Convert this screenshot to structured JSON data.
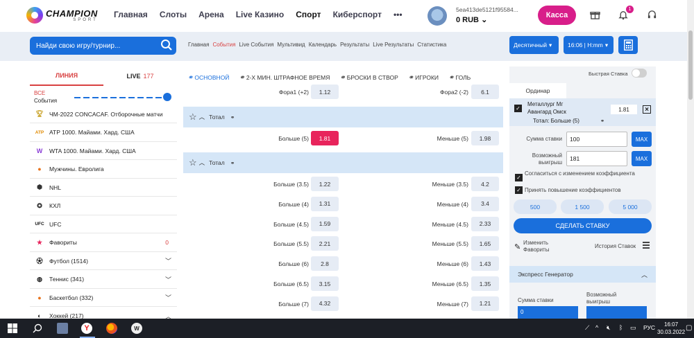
{
  "brand": {
    "name": "CHAMPION",
    "sub": "SPORT"
  },
  "nav": [
    "Главная",
    "Слоты",
    "Арена",
    "Live Казино",
    "Спорт",
    "Киберспорт",
    "•••"
  ],
  "account": {
    "id": "5ea413de5121f95584...",
    "balance": "0 RUB",
    "cashier": "Касса",
    "notifications": "1"
  },
  "search": {
    "placeholder": "Найди свою игру/турнир..."
  },
  "subnav": [
    "Главная",
    "События",
    "Live События",
    "Мультивид",
    "Календарь",
    "Результаты",
    "Live Результаты",
    "Статистика"
  ],
  "odds_format": "Десятичный",
  "time_format": "16:06 | H:mm",
  "sidebar": {
    "tab_line": "ЛИНИЯ",
    "tab_live": "LIVE",
    "live_count": "177",
    "events_all": "ВСЕ",
    "events_label": "События",
    "items": [
      {
        "label": "ЧМ-2022 CONCACAF. Отборочные матчи",
        "icon": "trophy-icon",
        "count": ""
      },
      {
        "label": "ATP 1000. Майами. Хард. США",
        "icon": "atp-logo-icon",
        "count": ""
      },
      {
        "label": "WTA 1000. Майами. Хард. США",
        "icon": "wta-logo-icon",
        "count": ""
      },
      {
        "label": "Мужчины. Евролига",
        "icon": "basketball-icon",
        "count": ""
      },
      {
        "label": "NHL",
        "icon": "nhl-logo-icon",
        "count": ""
      },
      {
        "label": "КХЛ",
        "icon": "khl-logo-icon",
        "count": ""
      },
      {
        "label": "UFC",
        "icon": "ufc-logo-icon",
        "count": ""
      },
      {
        "label": "Фавориты",
        "icon": "star-icon",
        "count": "0"
      },
      {
        "label": "Футбол (1514)",
        "icon": "football-icon",
        "count": ""
      },
      {
        "label": "Теннис (341)",
        "icon": "tennis-icon",
        "count": ""
      },
      {
        "label": "Баскетбол (332)",
        "icon": "basketball-icon",
        "count": ""
      },
      {
        "label": "Хоккей (217)",
        "icon": "hockey-icon",
        "count": ""
      }
    ]
  },
  "market_tabs": [
    "ОСНОВНОЙ",
    "2-Х МИН. ШТРАФНОЕ ВРЕМЯ",
    "БРОСКИ В СТВОР",
    "ИГРОКИ",
    "ГОЛЬ"
  ],
  "markets": {
    "fora_row": {
      "left_label": "Фора1 (+2)",
      "left_odd": "1.12",
      "right_label": "Фора2 (-2)",
      "right_odd": "6.1"
    },
    "total1": {
      "title": "Тотал",
      "rows": [
        {
          "left_label": "Больше (5)",
          "left_odd": "1.81",
          "right_label": "Меньше (5)",
          "right_odd": "1.98"
        }
      ]
    },
    "total2": {
      "title": "Тотал",
      "rows": [
        {
          "left_label": "Больше (3.5)",
          "left_odd": "1.22",
          "right_label": "Меньше (3.5)",
          "right_odd": "4.2"
        },
        {
          "left_label": "Больше (4)",
          "left_odd": "1.31",
          "right_label": "Меньше (4)",
          "right_odd": "3.4"
        },
        {
          "left_label": "Больше (4.5)",
          "left_odd": "1.59",
          "right_label": "Меньше (4.5)",
          "right_odd": "2.33"
        },
        {
          "left_label": "Больше (5.5)",
          "left_odd": "2.21",
          "right_label": "Меньше (5.5)",
          "right_odd": "1.65"
        },
        {
          "left_label": "Больше (6)",
          "left_odd": "2.8",
          "right_label": "Меньше (6)",
          "right_odd": "1.43"
        },
        {
          "left_label": "Больше (6.5)",
          "left_odd": "3.15",
          "right_label": "Меньше (6.5)",
          "right_odd": "1.35"
        },
        {
          "left_label": "Больше (7)",
          "left_odd": "4.32",
          "right_label": "Меньше (7)",
          "right_odd": "1.21"
        }
      ]
    }
  },
  "betslip": {
    "fast_bet": "Быстрая Ставка",
    "tab": "Ординар",
    "match": "Металлург Мг Авангард Омск",
    "odd": "1.81",
    "selection": "Тотал: Больше (5)",
    "stake_label": "Сумма ставки",
    "stake_value": "100",
    "win_label": "Возможный выигрыш",
    "win_value": "181",
    "max": "MAX",
    "agree_change": "Согласиться с изменением коэффициента",
    "accept_increase": "Принять повышение коэффициентов",
    "quick": [
      "500",
      "1 500",
      "5 000"
    ],
    "make_bet": "СДЕЛАТЬ СТАВКУ",
    "edit_favorites": "Изменить Фавориты",
    "history": "История Ставок"
  },
  "express": {
    "title": "Экспресс Генератор",
    "stake_label": "Сумма ставки",
    "win_label": "Возможный выигрыш",
    "stake_value": "0"
  },
  "taskbar": {
    "lang": "РУС",
    "time": "16:07",
    "date": "30.03.2022"
  },
  "colors": {
    "accent": "#1a6fdc",
    "brand_pink": "#d81e8a",
    "selected_odd": "#e8245c",
    "market_header": "#d5e6f7"
  }
}
